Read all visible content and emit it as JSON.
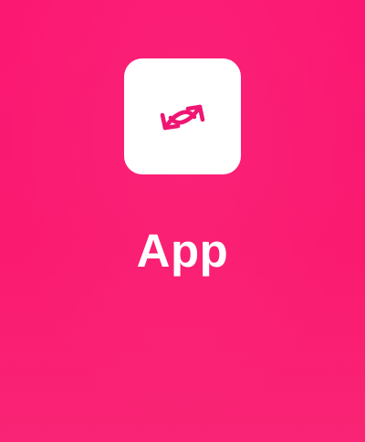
{
  "background": {
    "color": "#fb1a72"
  },
  "app": {
    "name": "App",
    "icon": "swap-arrows-icon",
    "icon_color": "#ee1672",
    "tile_color": "#ffffff"
  }
}
